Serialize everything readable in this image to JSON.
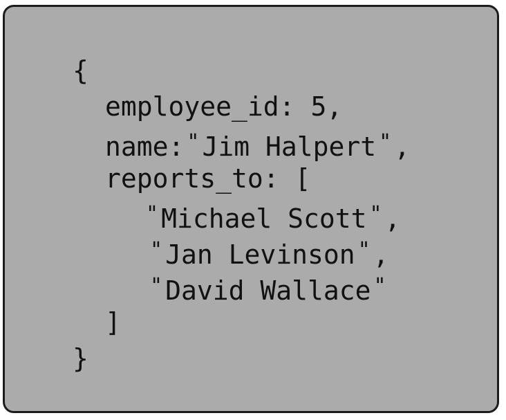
{
  "colors": {
    "card_background": "#ababab",
    "card_border": "#1c1c1c",
    "text": "#111111"
  },
  "record": {
    "open_brace": "{",
    "employee_id": {
      "key": "employee_id:",
      "value": "5",
      "comma": ","
    },
    "name": {
      "key": "name:",
      "value": "Jim Halpert",
      "comma": ","
    },
    "reports_to": {
      "key": "reports_to:",
      "open_bracket": "[",
      "items": [
        {
          "value": "Michael Scott",
          "comma": ","
        },
        {
          "value": "Jan Levinson",
          "comma": ","
        },
        {
          "value": "David Wallace",
          "comma": ""
        }
      ],
      "close_bracket": "]"
    },
    "close_brace": "}",
    "quote_mark": "\""
  }
}
